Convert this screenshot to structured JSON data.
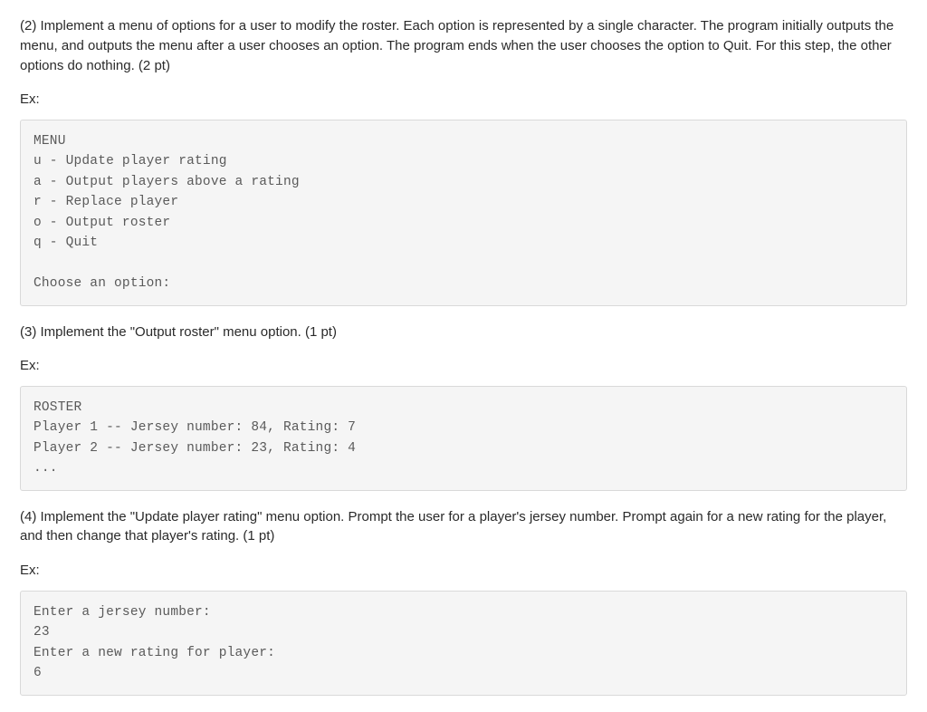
{
  "step2": {
    "text": "(2) Implement a menu of options for a user to modify the roster. Each option is represented by a single character. The program initially outputs the menu, and outputs the menu after a user chooses an option. The program ends when the user chooses the option to Quit. For this step, the other options do nothing. (2 pt)",
    "ex_label": "Ex:",
    "code": "MENU\nu - Update player rating\na - Output players above a rating\nr - Replace player\no - Output roster\nq - Quit\n\nChoose an option:"
  },
  "step3": {
    "text": "(3) Implement the \"Output roster\" menu option. (1 pt)",
    "ex_label": "Ex:",
    "code": "ROSTER\nPlayer 1 -- Jersey number: 84, Rating: 7\nPlayer 2 -- Jersey number: 23, Rating: 4\n..."
  },
  "step4": {
    "text": "(4) Implement the \"Update player rating\" menu option. Prompt the user for a player's jersey number. Prompt again for a new rating for the player, and then change that player's rating. (1 pt)",
    "ex_label": "Ex:",
    "code": "Enter a jersey number:\n23\nEnter a new rating for player:\n6"
  }
}
